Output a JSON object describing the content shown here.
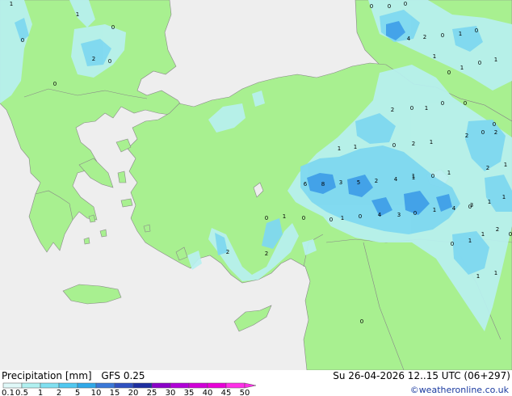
{
  "footer": {
    "title_parts": [
      "Precipitation [mm]",
      "GFS 0.25"
    ],
    "datetime": "Su 26-04-2026 12..15 UTC (06+297)",
    "credit": "©weatheronline.co.uk"
  },
  "legend": {
    "labels": [
      "0.1",
      "0.5",
      "1",
      "2",
      "5",
      "10",
      "15",
      "20",
      "25",
      "30",
      "35",
      "40",
      "45",
      "50"
    ],
    "colors": [
      "#e0f8f8",
      "#b0f0f0",
      "#80e0f0",
      "#50c8f0",
      "#30a8e8",
      "#3a78d8",
      "#2f50c0",
      "#1d2ea0",
      "#8a00c8",
      "#b000d8",
      "#d000d8",
      "#e800d8",
      "#ff30e8"
    ]
  },
  "map": {
    "colors": {
      "sea": "#eeeeee",
      "land": "#a8f090",
      "border": "#888888",
      "precip_light": "#b8f0f0",
      "precip_mid": "#7fd8f0",
      "precip_heavy": "#40a0e8"
    },
    "values": [
      "1",
      "0",
      "0",
      "0",
      "0",
      "2",
      "0",
      "1",
      "0",
      "0",
      "4",
      "2",
      "0",
      "1",
      "0",
      "1",
      "0",
      "1",
      "0",
      "1",
      "2",
      "0",
      "1",
      "0",
      "0",
      "0",
      "2",
      "2",
      "1",
      "1",
      "0",
      "2",
      "1",
      "2",
      "1",
      "0",
      "1",
      "1",
      "1",
      "0",
      "6",
      "8",
      "3",
      "5",
      "2",
      "4",
      "1",
      "0",
      "1",
      "0",
      "0",
      "1",
      "0",
      "4",
      "3",
      "0",
      "1",
      "4",
      "3",
      "1",
      "0",
      "1",
      "1",
      "2",
      "2",
      "2",
      "1",
      "1",
      "0",
      "0",
      "0"
    ]
  }
}
